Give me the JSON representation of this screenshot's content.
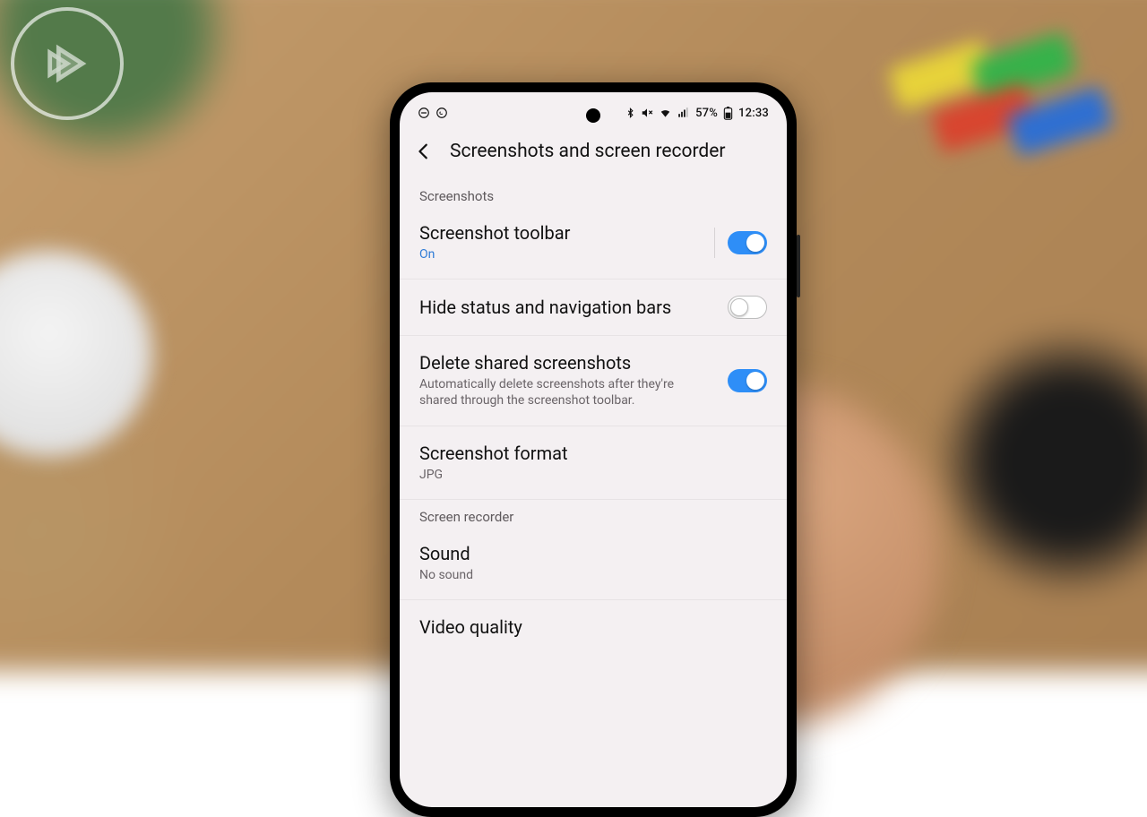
{
  "status": {
    "battery_pct": "57%",
    "time": "12:33"
  },
  "header": {
    "title": "Screenshots and screen recorder"
  },
  "sections": {
    "screenshots_label": "Screenshots",
    "recorder_label": "Screen recorder"
  },
  "rows": {
    "toolbar": {
      "label": "Screenshot toolbar",
      "sub": "On",
      "on": true
    },
    "hidebars": {
      "label": "Hide status and navigation bars",
      "on": false
    },
    "delete": {
      "label": "Delete shared screenshots",
      "sub": "Automatically delete screenshots after they're shared through the screenshot toolbar.",
      "on": true
    },
    "format": {
      "label": "Screenshot format",
      "sub": "JPG"
    },
    "sound": {
      "label": "Sound",
      "sub": "No sound"
    },
    "vquality": {
      "label": "Video quality"
    }
  }
}
